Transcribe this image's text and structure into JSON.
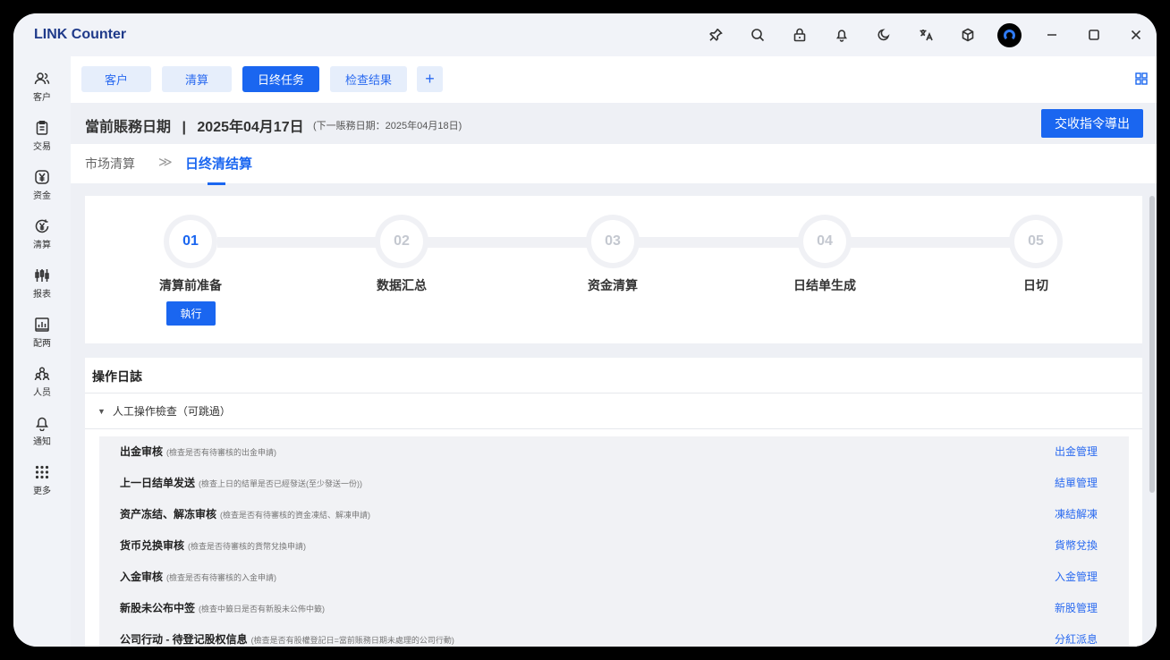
{
  "app": {
    "title": "LINK Counter"
  },
  "titlebar": {
    "icons": [
      "pin-icon",
      "search-icon",
      "lock-icon",
      "bell-icon",
      "moon-icon",
      "translate-icon",
      "cube-icon"
    ],
    "window_controls": [
      "minimize",
      "maximize",
      "close"
    ]
  },
  "sidebar": {
    "items": [
      {
        "label": "客户",
        "icon": "users-icon"
      },
      {
        "label": "交易",
        "icon": "clipboard-icon"
      },
      {
        "label": "资金",
        "icon": "yen-icon"
      },
      {
        "label": "清算",
        "icon": "yen-refresh-icon"
      },
      {
        "label": "报表",
        "icon": "candlestick-icon"
      },
      {
        "label": "配两",
        "icon": "bar-chart-icon"
      },
      {
        "label": "人员",
        "icon": "people-icon"
      },
      {
        "label": "通知",
        "icon": "bell-icon"
      },
      {
        "label": "更多",
        "icon": "dots-grid-icon"
      }
    ]
  },
  "tabs": [
    {
      "label": "客户",
      "active": false
    },
    {
      "label": "清算",
      "active": false
    },
    {
      "label": "日终任务",
      "active": true
    },
    {
      "label": "检查结果",
      "active": false
    },
    {
      "label": "+",
      "active": false
    }
  ],
  "date_bar": {
    "label": "當前賬務日期",
    "separator": "|",
    "date": "2025年04月17日",
    "next": "(下一賬務日期：2025年04月18日)",
    "export_button": "交收指令導出"
  },
  "breadcrumb": {
    "parent": "市场清算",
    "separator": "≫",
    "current": "日终清结算"
  },
  "steps": [
    {
      "num": "01",
      "label": "清算前准备",
      "active": true,
      "action": "執行"
    },
    {
      "num": "02",
      "label": "数据汇总",
      "active": false
    },
    {
      "num": "03",
      "label": "资金清算",
      "active": false
    },
    {
      "num": "04",
      "label": "日结单生成",
      "active": false
    },
    {
      "num": "05",
      "label": "日切",
      "active": false
    }
  ],
  "log": {
    "title": "操作日誌",
    "group": "人工操作檢查（可跳過）",
    "rows": [
      {
        "name": "出金审核",
        "note": "(檢查是否有待審核的出金申請)",
        "link": "出金管理"
      },
      {
        "name": "上一日结单发送",
        "note": "(檢查上日的結單是否已經發送(至少發送一份))",
        "link": "結單管理"
      },
      {
        "name": "资产冻结、解冻审核",
        "note": "(檢查是否有待審核的資金凍結、解凍申請)",
        "link": "凍結解凍"
      },
      {
        "name": "货币兑换审核",
        "note": "(檢查是否待審核的貨幣兌換申請)",
        "link": "貨幣兌換"
      },
      {
        "name": "入金审核",
        "note": "(檢查是否有待審核的入金申請)",
        "link": "入金管理"
      },
      {
        "name": "新股未公布中签",
        "note": "(檢查中籤日是否有新股未公佈中籤)",
        "link": "新股管理"
      },
      {
        "name": "公司行动 - 待登记股权信息",
        "note": "(檢查是否有股權登記日=當前賬務日期未處理的公司行動)",
        "link": "分紅派息"
      }
    ]
  },
  "colors": {
    "accent": "#1a66f0",
    "brand_title": "#1f3a8a"
  }
}
